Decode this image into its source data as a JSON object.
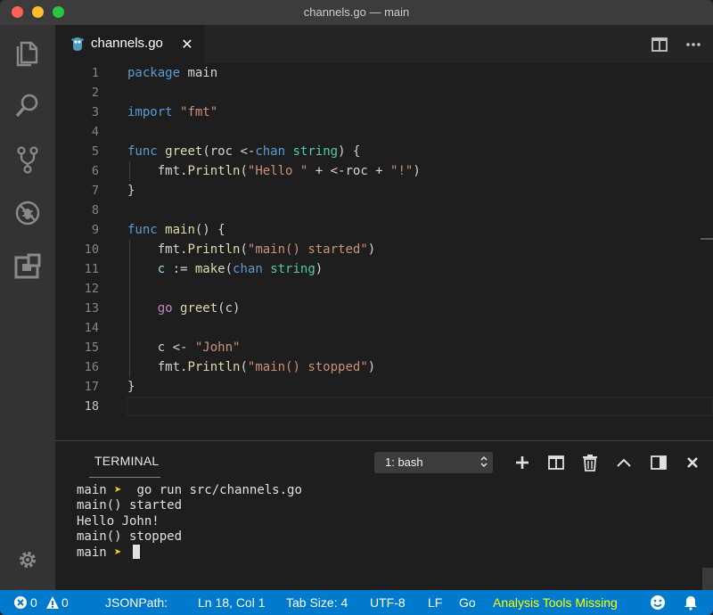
{
  "window": {
    "title": "channels.go — main"
  },
  "activity_bar": {
    "items": [
      "explorer-icon",
      "search-icon",
      "source-control-icon",
      "debug-icon",
      "extensions-icon"
    ],
    "bottom": "settings-gear-icon"
  },
  "tab": {
    "label": "channels.go",
    "close": "✕",
    "icon": "go-gopher-icon"
  },
  "editor": {
    "line_numbers": [
      "1",
      "2",
      "3",
      "4",
      "5",
      "6",
      "7",
      "8",
      "9",
      "10",
      "11",
      "12",
      "13",
      "14",
      "15",
      "16",
      "17",
      "18"
    ],
    "lines": [
      [
        {
          "t": "package ",
          "c": "kw"
        },
        {
          "t": "main",
          "c": ""
        }
      ],
      [],
      [
        {
          "t": "import ",
          "c": "kw"
        },
        {
          "t": "\"fmt\"",
          "c": "str"
        }
      ],
      [],
      [
        {
          "t": "func ",
          "c": "kw"
        },
        {
          "t": "greet",
          "c": "fn"
        },
        {
          "t": "(roc <-",
          "c": ""
        },
        {
          "t": "chan ",
          "c": "kw"
        },
        {
          "t": "string",
          "c": "ty"
        },
        {
          "t": ") {",
          "c": ""
        }
      ],
      [
        {
          "t": "    fmt.",
          "c": ""
        },
        {
          "t": "Println",
          "c": "fn"
        },
        {
          "t": "(",
          "c": ""
        },
        {
          "t": "\"Hello \"",
          "c": "str"
        },
        {
          "t": " + <-roc + ",
          "c": ""
        },
        {
          "t": "\"!\"",
          "c": "str"
        },
        {
          "t": ")",
          "c": ""
        }
      ],
      [
        {
          "t": "}",
          "c": ""
        }
      ],
      [],
      [
        {
          "t": "func ",
          "c": "kw"
        },
        {
          "t": "main",
          "c": "fn"
        },
        {
          "t": "() {",
          "c": ""
        }
      ],
      [
        {
          "t": "    fmt.",
          "c": ""
        },
        {
          "t": "Println",
          "c": "fn"
        },
        {
          "t": "(",
          "c": ""
        },
        {
          "t": "\"main() started\"",
          "c": "str"
        },
        {
          "t": ")",
          "c": ""
        }
      ],
      [
        {
          "t": "    ",
          "c": ""
        },
        {
          "t": "c",
          "c": "var"
        },
        {
          "t": " := ",
          "c": ""
        },
        {
          "t": "make",
          "c": "fn"
        },
        {
          "t": "(",
          "c": ""
        },
        {
          "t": "chan ",
          "c": "kw"
        },
        {
          "t": "string",
          "c": "ty"
        },
        {
          "t": ")",
          "c": ""
        }
      ],
      [],
      [
        {
          "t": "    ",
          "c": ""
        },
        {
          "t": "go ",
          "c": "pink"
        },
        {
          "t": "greet",
          "c": "fn"
        },
        {
          "t": "(c)",
          "c": ""
        }
      ],
      [],
      [
        {
          "t": "    c <- ",
          "c": ""
        },
        {
          "t": "\"John\"",
          "c": "str"
        }
      ],
      [
        {
          "t": "    fmt.",
          "c": ""
        },
        {
          "t": "Println",
          "c": "fn"
        },
        {
          "t": "(",
          "c": ""
        },
        {
          "t": "\"main() stopped\"",
          "c": "str"
        },
        {
          "t": ")",
          "c": ""
        }
      ],
      [
        {
          "t": "}",
          "c": ""
        }
      ],
      []
    ]
  },
  "panel": {
    "title": "TERMINAL",
    "terminal_select": "1: bash",
    "actions": [
      "new-terminal-icon",
      "split-terminal-icon",
      "trash-icon",
      "maximize-panel-icon",
      "toggle-panel-position-icon",
      "close-panel-icon"
    ],
    "prompt_dir": "main",
    "prompt_arrow": "➤",
    "command": "go run src/channels.go",
    "output": [
      "main() started",
      "Hello John!",
      "main() stopped"
    ]
  },
  "status_bar": {
    "errors": "0",
    "warnings": "0",
    "jsonpath": "JSONPath:",
    "position": "Ln 18, Col 1",
    "tab_size": "Tab Size: 4",
    "encoding": "UTF-8",
    "eol": "LF",
    "language": "Go",
    "analysis": "Analysis Tools Missing"
  },
  "colors": {
    "status_bar": "#007acc",
    "keyword": "#569cd6",
    "function": "#dcdcaa",
    "string": "#ce9178",
    "type": "#4ec9b0",
    "control": "#c586c0"
  }
}
